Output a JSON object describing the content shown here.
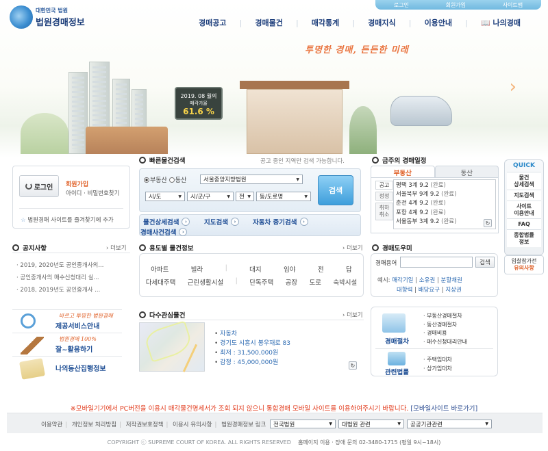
{
  "top_links": [
    "로그인",
    "회원가입",
    "사이트맵"
  ],
  "logo": {
    "small": "대한민국 법원",
    "big": "법원경매정보"
  },
  "gnb": [
    "경매공고",
    "경매물건",
    "매각통계",
    "경매지식",
    "이용안내",
    "나의경매"
  ],
  "slogan": "투명한 경매, 든든한 미래",
  "sign": {
    "l1": "2019. 08 월의",
    "l2": "매각가율",
    "l3": "61.6 %"
  },
  "login": {
    "button": "로그인",
    "join": "회원가입",
    "find": "아이디 · 비밀번호찾기",
    "favorite": "법원경매 사이트를 즐겨찾기에 추가"
  },
  "quick_search": {
    "title": "빠른물건검색",
    "desc": "공고 중인 지역만 검색 가능합니다.",
    "radio_realestate": "부동산",
    "radio_movable": "동산",
    "court": "서울중앙지방법원",
    "sido": "시/도",
    "sigungu": "시/군/구",
    "dong_prefix": "전",
    "dong": "동/도로명",
    "button": "검색"
  },
  "quick_links": [
    "물건상세검색",
    "지도검색",
    "자동차 중기검색",
    "경매사건검색"
  ],
  "weekly": {
    "title": "금주의 경매일정",
    "tabs": [
      "부동산",
      "동산"
    ],
    "side_tabs": [
      "공고",
      "정정",
      "취하\n취소"
    ],
    "items": [
      {
        "court": "평택 3계",
        "date": "9.2",
        "status": "(완료)"
      },
      {
        "court": "서울북부 9계",
        "date": "9.2",
        "status": "(완료)"
      },
      {
        "court": "춘천 4계",
        "date": "9.2",
        "status": "(완료)"
      },
      {
        "court": "포항 4계",
        "date": "9.2",
        "status": "(완료)"
      },
      {
        "court": "서울동부 3계",
        "date": "9.2",
        "status": "(완료)"
      }
    ]
  },
  "quick_menu": {
    "title": "QUICK",
    "items": [
      "물건\n상세검색",
      "지도검색",
      "사이트\n이용안내",
      "FAQ",
      "종합법률\n정보"
    ],
    "caution": [
      "입찰참가전",
      "유의사항"
    ]
  },
  "notice": {
    "title": "공지사항",
    "more": "더보기",
    "items": [
      "2019, 2020년도 공인중개사의...",
      "공인중개사의 매수신청대리 실...",
      "2018, 2019년도 공인중개사 ..."
    ]
  },
  "category": {
    "title": "용도별 물건정보",
    "more": "더보기",
    "row1": [
      "아파트",
      "빌라",
      "대지",
      "임야",
      "전",
      "답"
    ],
    "row2": [
      "다세대주택",
      "근린생활시설",
      "단독주택",
      "공장",
      "도로",
      "숙박시설"
    ]
  },
  "dict": {
    "title": "경매도우미",
    "label": "경매용어",
    "button": "검색",
    "example": "예시:",
    "terms": [
      "매각기일",
      "소유권",
      "분할채권",
      "대항력",
      "배당요구",
      "지상권"
    ]
  },
  "interest": {
    "title": "다수관심물건",
    "more": "더보기",
    "items": [
      "자동차",
      "경기도 시흥시 봉우재로 83",
      "최저 : 31,500,000원",
      "감정 : 45,000,000원"
    ]
  },
  "banners": [
    {
      "sub": "바르고 투명한 법원경매",
      "title": "제공서비스안내"
    },
    {
      "sub": "법원경매 100%",
      "title": "잘~활용하기"
    },
    {
      "sub": "",
      "title": "나의동산집행정보"
    }
  ],
  "procedure": {
    "group1": "경매절차",
    "group1_items": [
      "부동산경매절차",
      "동산경매절차",
      "경매비용",
      "매수신청대리안내"
    ],
    "group2": "관련법률",
    "group2_items": [
      "주택임대차",
      "상가임대차"
    ]
  },
  "alert": {
    "text": "※모바일기기에서 PC버전을 이용시 매각물건명세서가 조회 되지 않으니 통합경매 모바일 사이트를 이용하여주시기 바랍니다.",
    "link": "[모바일사이트 바로가기]"
  },
  "footer": {
    "links": [
      "이용약관",
      "개인정보 처리방침",
      "저작권보호정책",
      "이용시 유의사항",
      "법원경매정보 링크"
    ],
    "selects": [
      "전국법원",
      "대법원 관련",
      "공공기관관련"
    ],
    "copyright": "COPYRIGHT ⓒ  SUPREME COURT OF KOREA. ALL RIGHTS RESERVED",
    "contact": "홈페이지 이용 · 장애 문의 02-3480-1715 (평일 9시~18시)"
  },
  "colors": {
    "accent": "#e0622a",
    "navy": "#1e3f7c",
    "blue": "#3d9edb"
  }
}
